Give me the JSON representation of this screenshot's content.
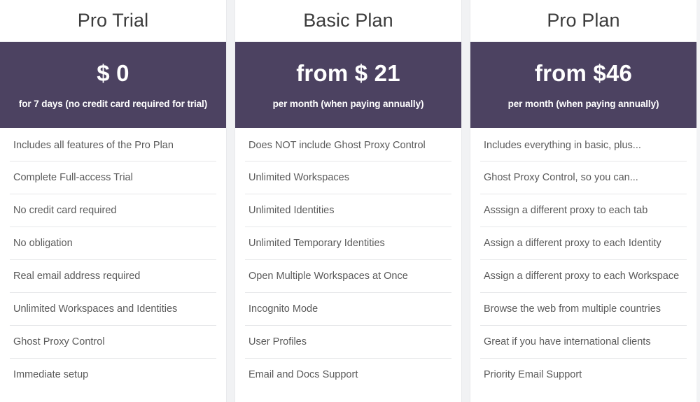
{
  "theme": {
    "band_color": "#4c4261",
    "page_background": "#ffffff",
    "gutter_color": "#f1f2f4",
    "title_color": "#3c3c3c",
    "feature_text_color": "#5a5a5a",
    "divider_color": "#e6e7e9"
  },
  "plans": [
    {
      "title": "Pro Trial",
      "price": "$ 0",
      "price_note": "for 7 days (no credit card required for trial)",
      "features": [
        "Includes all features of the Pro Plan",
        "Complete Full-access Trial",
        "No credit card required",
        "No obligation",
        "Real email address required",
        "Unlimited Workspaces and Identities",
        "Ghost Proxy Control",
        "Immediate setup"
      ]
    },
    {
      "title": "Basic Plan",
      "price": "from $ 21",
      "price_note": "per month (when paying annually)",
      "features": [
        "Does NOT include Ghost Proxy Control",
        "Unlimited Workspaces",
        "Unlimited Identities",
        "Unlimited Temporary Identities",
        "Open Multiple Workspaces at Once",
        "Incognito Mode",
        "User Profiles",
        "Email and Docs Support"
      ]
    },
    {
      "title": "Pro Plan",
      "price": "from $46",
      "price_note": "per month (when paying annually)",
      "features": [
        "Includes everything in basic, plus...",
        "Ghost Proxy Control, so you can...",
        "Asssign a different proxy to each tab",
        "Assign a different proxy to each Identity",
        "Assign a different proxy to each Workspace",
        "Browse the web from multiple countries",
        "Great if you have international clients",
        "Priority Email Support"
      ]
    }
  ]
}
